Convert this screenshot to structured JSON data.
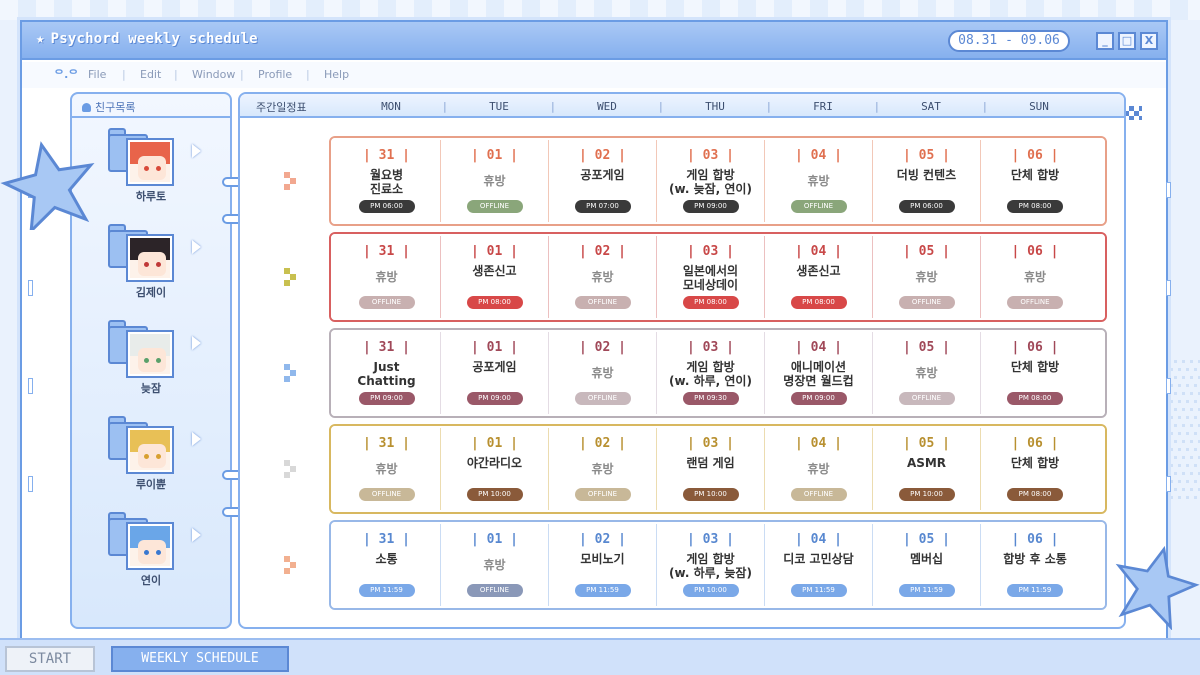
{
  "window": {
    "title": "Psychord weekly schedule",
    "date_range": "08.31 - 09.06",
    "btn_min": "_",
    "btn_max": "□",
    "btn_close": "X"
  },
  "menu": {
    "logo": "ᄋ.ᄋ",
    "items": [
      "File",
      "Edit",
      "Window",
      "Profile",
      "Help"
    ]
  },
  "sidebar": {
    "header": "친구목록",
    "friends": [
      {
        "name": "하루토",
        "hair": "#e8644a",
        "eye": "#d84a3a"
      },
      {
        "name": "김제이",
        "hair": "#2c2428",
        "eye": "#c03838"
      },
      {
        "name": "늦잠",
        "hair": "#e8ecea",
        "eye": "#5aa06a"
      },
      {
        "name": "루이쁀",
        "hair": "#e8c056",
        "eye": "#d8a030"
      },
      {
        "name": "연이",
        "hair": "#6aa6e8",
        "eye": "#3a78d0"
      }
    ]
  },
  "main": {
    "header_label": "주간일정표",
    "days": [
      "MON",
      "TUE",
      "WED",
      "THU",
      "FRI",
      "SAT",
      "SUN"
    ]
  },
  "rows": [
    {
      "member": "하루토",
      "color": "#e8a088",
      "date_color": "#e07050",
      "line": "#f2c8b8",
      "cells": [
        {
          "date": "| 31 |",
          "title": "월요병\n진료소",
          "time": "PM 06:00",
          "pill": "#3a3a3a"
        },
        {
          "date": "| 01 |",
          "title": "휴방",
          "time": "OFFLINE",
          "pill": "#8aa67a",
          "off": true
        },
        {
          "date": "| 02 |",
          "title": "공포게임",
          "time": "PM 07:00",
          "pill": "#3a3a3a"
        },
        {
          "date": "| 03 |",
          "title": "게임 합방\n(w. 늦잠, 연이)",
          "time": "PM 09:00",
          "pill": "#3a3a3a"
        },
        {
          "date": "| 04 |",
          "title": "휴방",
          "time": "OFFLINE",
          "pill": "#8aa67a",
          "off": true
        },
        {
          "date": "| 05 |",
          "title": "더빙 컨텐츠",
          "time": "PM 06:00",
          "pill": "#3a3a3a"
        },
        {
          "date": "| 06 |",
          "title": "단체 합방",
          "time": "PM 08:00",
          "pill": "#3a3a3a"
        }
      ]
    },
    {
      "member": "김제이",
      "color": "#d86060",
      "date_color": "#c84848",
      "line": "#ecc0c0",
      "cells": [
        {
          "date": "| 31 |",
          "title": "휴방",
          "time": "OFFLINE",
          "pill": "#c8b0b0",
          "off": true
        },
        {
          "date": "| 01 |",
          "title": "생존신고",
          "time": "PM 08:00",
          "pill": "#d84848"
        },
        {
          "date": "| 02 |",
          "title": "휴방",
          "time": "OFFLINE",
          "pill": "#c8b0b0",
          "off": true
        },
        {
          "date": "| 03 |",
          "title": "일본에서의\n모네상데이",
          "time": "PM 08:00",
          "pill": "#d84848"
        },
        {
          "date": "| 04 |",
          "title": "생존신고",
          "time": "PM 08:00",
          "pill": "#d84848"
        },
        {
          "date": "| 05 |",
          "title": "휴방",
          "time": "OFFLINE",
          "pill": "#c8b0b0",
          "off": true
        },
        {
          "date": "| 06 |",
          "title": "휴방",
          "time": "OFFLINE",
          "pill": "#c8b0b0",
          "off": true
        }
      ]
    },
    {
      "member": "늦잠",
      "color": "#b8b0b8",
      "date_color": "#a04858",
      "line": "#e4dce4",
      "cells": [
        {
          "date": "| 31 |",
          "title": "Just\nChatting",
          "time": "PM 09:00",
          "pill": "#9a5868"
        },
        {
          "date": "| 01 |",
          "title": "공포게임",
          "time": "PM 09:00",
          "pill": "#9a5868"
        },
        {
          "date": "| 02 |",
          "title": "휴방",
          "time": "OFFLINE",
          "pill": "#c8b8bc",
          "off": true
        },
        {
          "date": "| 03 |",
          "title": "게임 합방\n(w. 하루, 연이)",
          "time": "PM 09:30",
          "pill": "#9a5868"
        },
        {
          "date": "| 04 |",
          "title": "애니메이션\n명장면 월드컵",
          "time": "PM 09:00",
          "pill": "#9a5868"
        },
        {
          "date": "| 05 |",
          "title": "휴방",
          "time": "OFFLINE",
          "pill": "#c8b8bc",
          "off": true
        },
        {
          "date": "| 06 |",
          "title": "단체 합방",
          "time": "PM 08:00",
          "pill": "#9a5868"
        }
      ]
    },
    {
      "member": "루이쁀",
      "color": "#d8b860",
      "date_color": "#b89030",
      "line": "#ecdcb0",
      "cells": [
        {
          "date": "| 31 |",
          "title": "휴방",
          "time": "OFFLINE",
          "pill": "#c8b898",
          "off": true
        },
        {
          "date": "| 01 |",
          "title": "야간라디오",
          "time": "PM 10:00",
          "pill": "#8a5a3a"
        },
        {
          "date": "| 02 |",
          "title": "휴방",
          "time": "OFFLINE",
          "pill": "#c8b898",
          "off": true
        },
        {
          "date": "| 03 |",
          "title": "랜덤 게임",
          "time": "PM 10:00",
          "pill": "#8a5a3a"
        },
        {
          "date": "| 04 |",
          "title": "휴방",
          "time": "OFFLINE",
          "pill": "#c8b898",
          "off": true
        },
        {
          "date": "| 05 |",
          "title": "ASMR",
          "time": "PM 10:00",
          "pill": "#8a5a3a"
        },
        {
          "date": "| 06 |",
          "title": "단체 합방",
          "time": "PM 08:00",
          "pill": "#8a5a3a"
        }
      ]
    },
    {
      "member": "연이",
      "color": "#98b8e8",
      "date_color": "#5888d0",
      "line": "#cadcf4",
      "cells": [
        {
          "date": "| 31 |",
          "title": "소통",
          "time": "PM 11:59",
          "pill": "#7aa8e8"
        },
        {
          "date": "| 01 |",
          "title": "휴방",
          "time": "OFFLINE",
          "pill": "#8a98b8",
          "off": true
        },
        {
          "date": "| 02 |",
          "title": "모비노기",
          "time": "PM 11:59",
          "pill": "#7aa8e8"
        },
        {
          "date": "| 03 |",
          "title": "게임 합방\n(w. 하루, 늦잠)",
          "time": "PM 10:00",
          "pill": "#7aa8e8"
        },
        {
          "date": "| 04 |",
          "title": "디코 고민상담",
          "time": "PM 11:59",
          "pill": "#7aa8e8"
        },
        {
          "date": "| 05 |",
          "title": "멤버십",
          "time": "PM 11:59",
          "pill": "#7aa8e8"
        },
        {
          "date": "| 06 |",
          "title": "합방 후 소통",
          "time": "PM 11:59",
          "pill": "#7aa8e8"
        }
      ]
    }
  ],
  "taskbar": {
    "start": "START",
    "task": "WEEKLY SCHEDULE"
  }
}
